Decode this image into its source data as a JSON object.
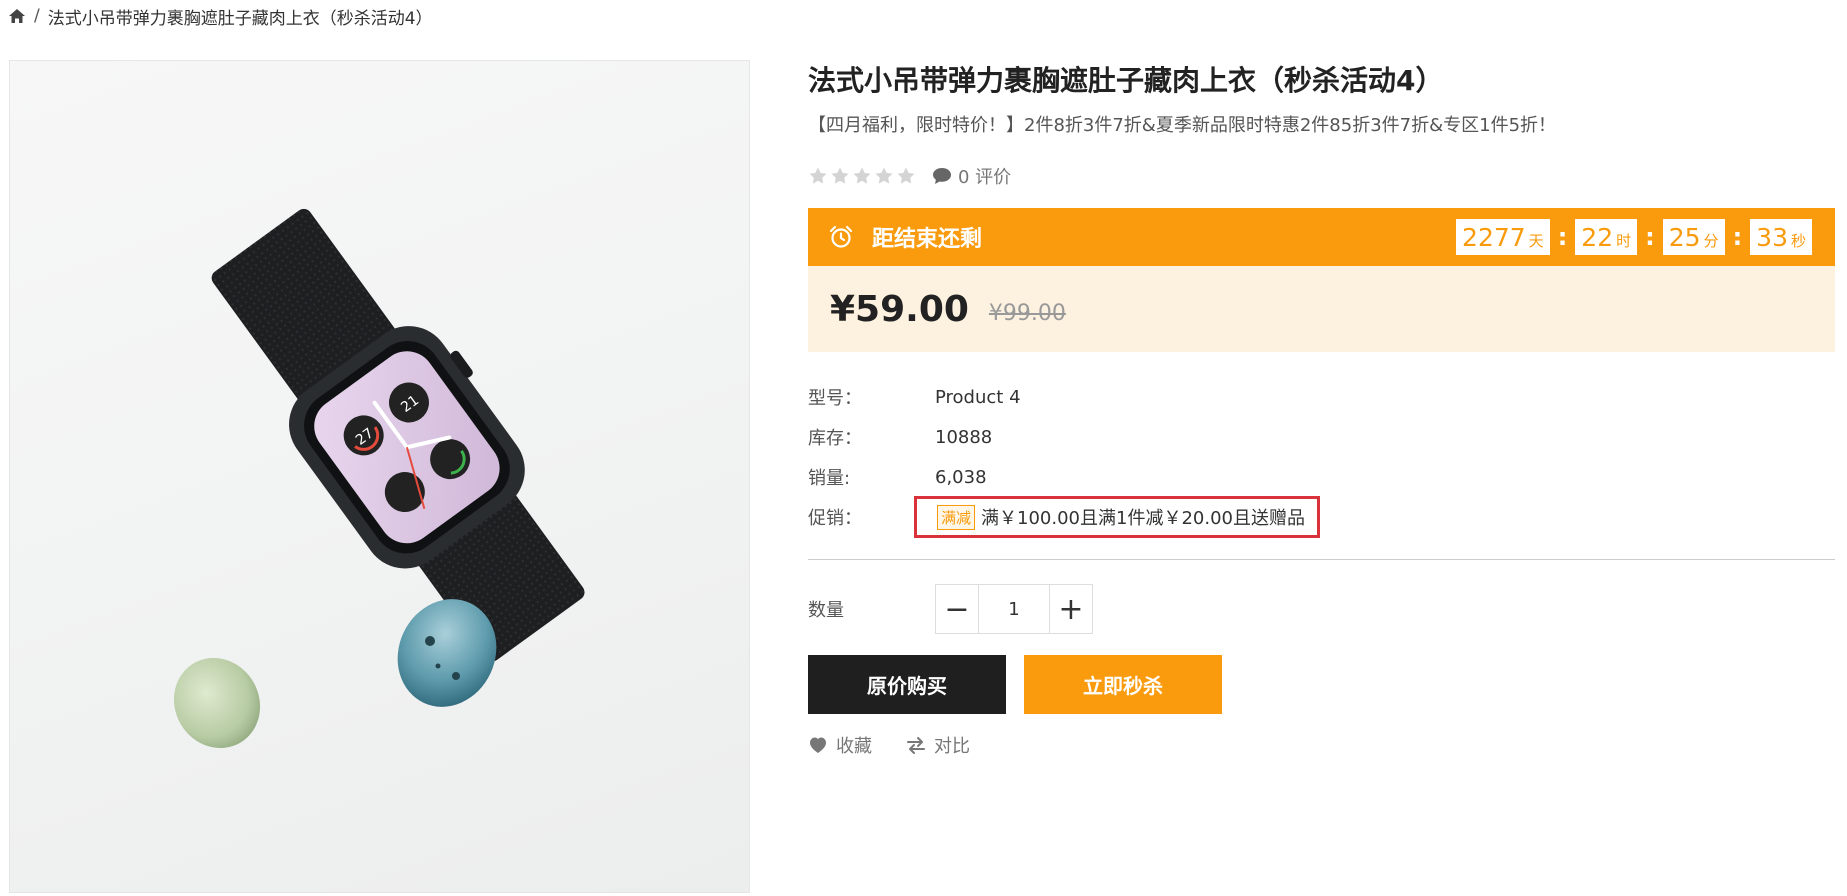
{
  "breadcrumb": {
    "separator": "/",
    "current": "法式小吊带弹力裹胸遮肚子藏肉上衣（秒杀活动4）"
  },
  "product": {
    "title": "法式小吊带弹力裹胸遮肚子藏肉上衣（秒杀活动4）",
    "subtitle": "【四月福利，限时特价！】2件8折3件7折&夏季新品限时特惠2件85折3件7折&专区1件5折！",
    "rating": 0,
    "review_count_text": "0 评价",
    "image_icon": "apple-watch-product-photo"
  },
  "flash_sale": {
    "label": "距结束还剩",
    "icon": "alarm-clock-icon",
    "colon": ":",
    "countdown": [
      {
        "value": "2277",
        "unit": "天"
      },
      {
        "value": "22",
        "unit": "时"
      },
      {
        "value": "25",
        "unit": "分"
      },
      {
        "value": "33",
        "unit": "秒"
      }
    ]
  },
  "pricing": {
    "price": "¥59.00",
    "original_price": "¥99.00"
  },
  "attributes": {
    "model_label": "型号：",
    "model_value": "Product 4",
    "stock_label": "库存：",
    "stock_value": "10888",
    "sales_label": "销量:",
    "sales_value": "6,038",
    "promo_label": "促销：",
    "promo_badge": "满减",
    "promo_text": "满￥100.00且满1件减￥20.00且送赠品"
  },
  "quantity": {
    "label": "数量",
    "minus": "−",
    "plus": "+",
    "value": "1"
  },
  "buttons": {
    "buy_original": "原价购买",
    "buy_flash": "立即秒杀"
  },
  "actions": {
    "favorite": "收藏",
    "compare": "对比"
  },
  "colors": {
    "accent": "#f99b0c",
    "price_bg": "#fdf1e0",
    "dark_button": "#1f1f1f",
    "promo_frame": "#d9323a"
  }
}
